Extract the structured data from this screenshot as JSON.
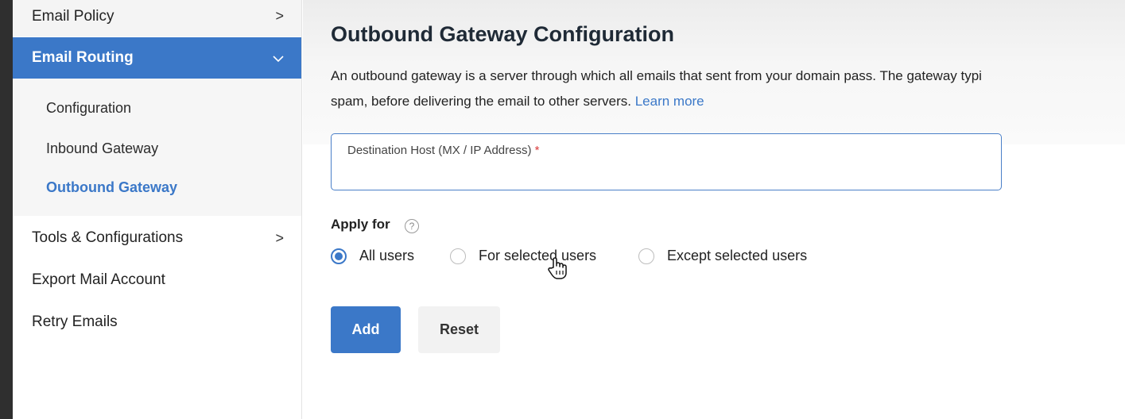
{
  "sidebar": {
    "email_policy": "Email Policy",
    "email_routing": "Email Routing",
    "sub_items": [
      "Configuration",
      "Inbound Gateway",
      "Outbound Gateway"
    ],
    "active_sub_item": "Outbound Gateway",
    "tools": "Tools & Configurations",
    "export": "Export Mail Account",
    "retry": "Retry Emails"
  },
  "main": {
    "title": "Outbound Gateway Configuration",
    "description_line1": "An outbound gateway is a server through which all emails that sent from your domain pass. The gateway typi",
    "description_line2": "spam, before delivering the email to other servers.",
    "learn_more": "Learn more",
    "field": {
      "label": "Destination Host (MX / IP Address)",
      "required_mark": "*",
      "value": ""
    },
    "apply_for": {
      "label": "Apply for",
      "options": [
        "All users",
        "For selected users",
        "Except selected users"
      ],
      "selected": "All users"
    },
    "buttons": {
      "add": "Add",
      "reset": "Reset"
    }
  },
  "colors": {
    "accent": "#3b78c8",
    "required": "#d93b3b"
  }
}
